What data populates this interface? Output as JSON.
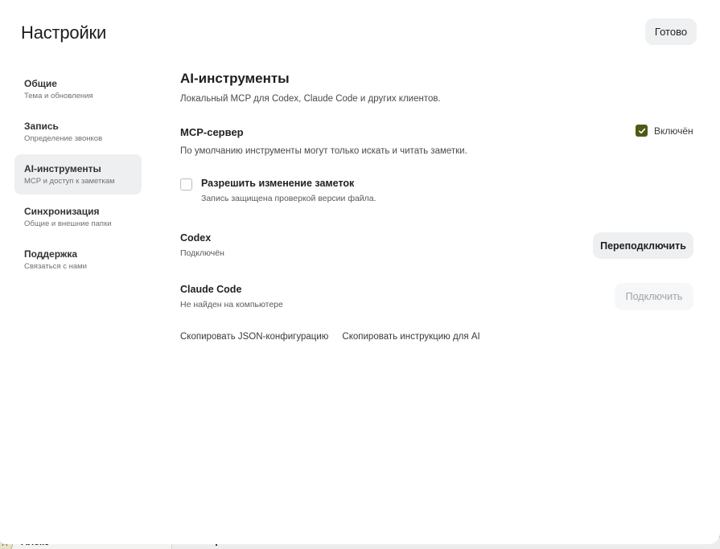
{
  "background": {
    "user_initial": "А",
    "user_name": "Алекс"
  },
  "header": {
    "title": "Настройки",
    "done_label": "Готово"
  },
  "sidebar": {
    "items": [
      {
        "label": "Общие",
        "sub": "Тема и обновления",
        "active": false
      },
      {
        "label": "Запись",
        "sub": "Определение звонков",
        "active": false
      },
      {
        "label": "AI-инструменты",
        "sub": "MCP и доступ к заметкам",
        "active": true
      },
      {
        "label": "Синхронизация",
        "sub": "Общие и внешние папки",
        "active": false
      },
      {
        "label": "Поддержка",
        "sub": "Связаться с нами",
        "active": false
      }
    ]
  },
  "main": {
    "title": "AI-инструменты",
    "lead": "Локальный MCP для Codex, Claude Code и других клиентов.",
    "mcp": {
      "title": "MCP-сервер",
      "description": "По умолчанию инструменты могут только искать и читать заметки.",
      "toggle_label": "Включён",
      "enabled": true
    },
    "permission": {
      "title": "Разрешить изменение заметок",
      "subtitle": "Запись защищена проверкой версии файла.",
      "checked": false
    },
    "clients": [
      {
        "name": "Codex",
        "status": "Подключён",
        "action": "Переподключить",
        "disabled": false
      },
      {
        "name": "Claude Code",
        "status": "Не найден на компьютере",
        "action": "Подключить",
        "disabled": true
      }
    ],
    "links": {
      "copy_json": "Скопировать JSON-конфигурацию",
      "copy_instructions": "Скопировать инструкцию для AI"
    }
  },
  "colors": {
    "accent": "#4f5a12",
    "active_nav_bg": "#edeff1",
    "button_bg": "#eef0f2"
  }
}
